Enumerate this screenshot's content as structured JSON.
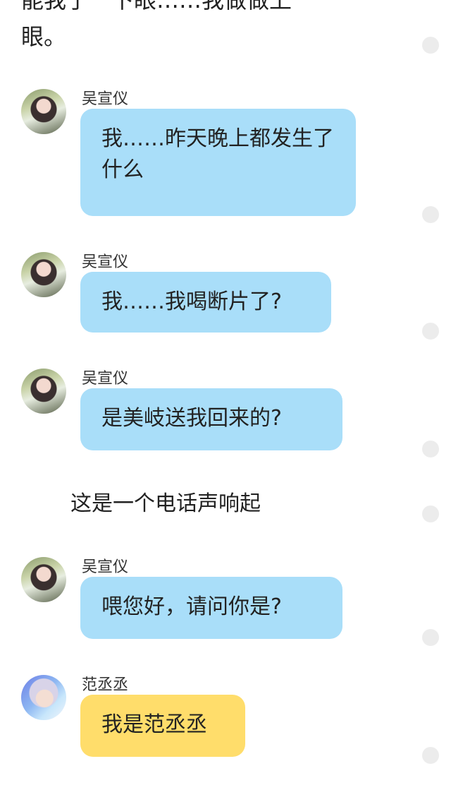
{
  "narration": {
    "cut_line": "能我了一下眼……我做做上",
    "eye_line": "眼。",
    "ring_line": "这是一个电话声响起"
  },
  "messages": [
    {
      "sender": "吴宣仪",
      "text": "我……昨天晚上都发生了什么",
      "style": "blue",
      "avatar": "wu"
    },
    {
      "sender": "吴宣仪",
      "text": "我……我喝断片了?",
      "style": "blue",
      "avatar": "wu"
    },
    {
      "sender": "吴宣仪",
      "text": "是美岐送我回来的?",
      "style": "blue",
      "avatar": "wu"
    },
    {
      "sender": "吴宣仪",
      "text": "喂您好，请问你是?",
      "style": "blue",
      "avatar": "wu"
    },
    {
      "sender": "范丞丞",
      "text": "我是范丞丞",
      "style": "yellow",
      "avatar": "fan"
    }
  ],
  "colors": {
    "bubble_blue": "#a9def9",
    "bubble_yellow": "#ffdd6b",
    "indicator_dot": "#ececec"
  }
}
